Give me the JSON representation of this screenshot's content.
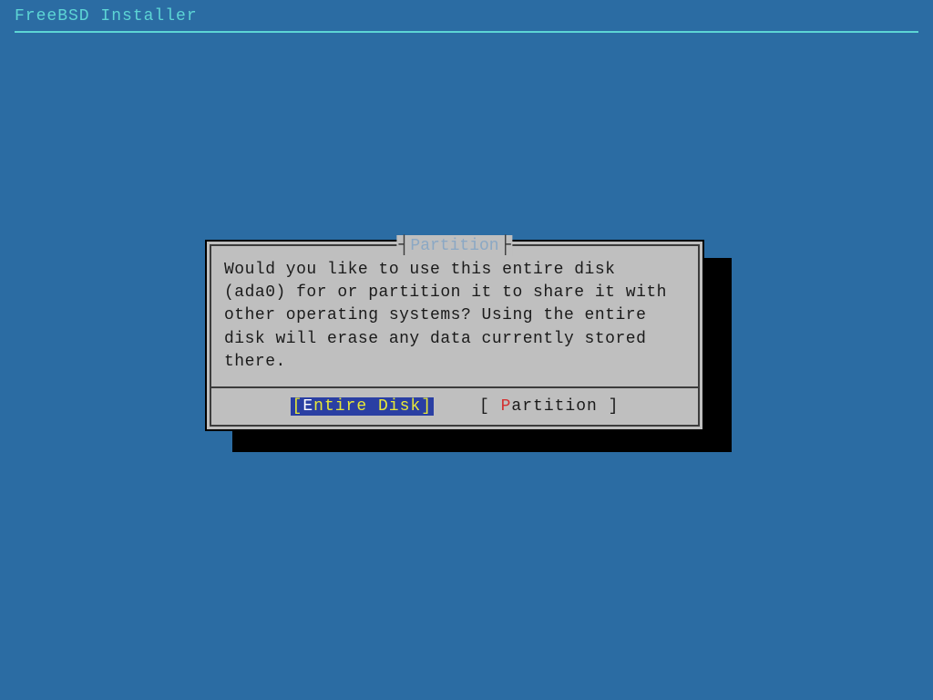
{
  "header": {
    "title": "FreeBSD Installer"
  },
  "dialog": {
    "title": "Partition",
    "message": "Would you like to use this entire disk (ada0) for  or partition it to share it with other operating systems? Using the entire disk will erase any data currently stored there.",
    "buttons": {
      "entire_disk": {
        "open": "[",
        "hotkey": "E",
        "rest": "ntire Disk",
        "close": "]"
      },
      "partition": {
        "open": "[ ",
        "hotkey": "P",
        "rest": "artition ",
        "close": "]"
      }
    }
  }
}
